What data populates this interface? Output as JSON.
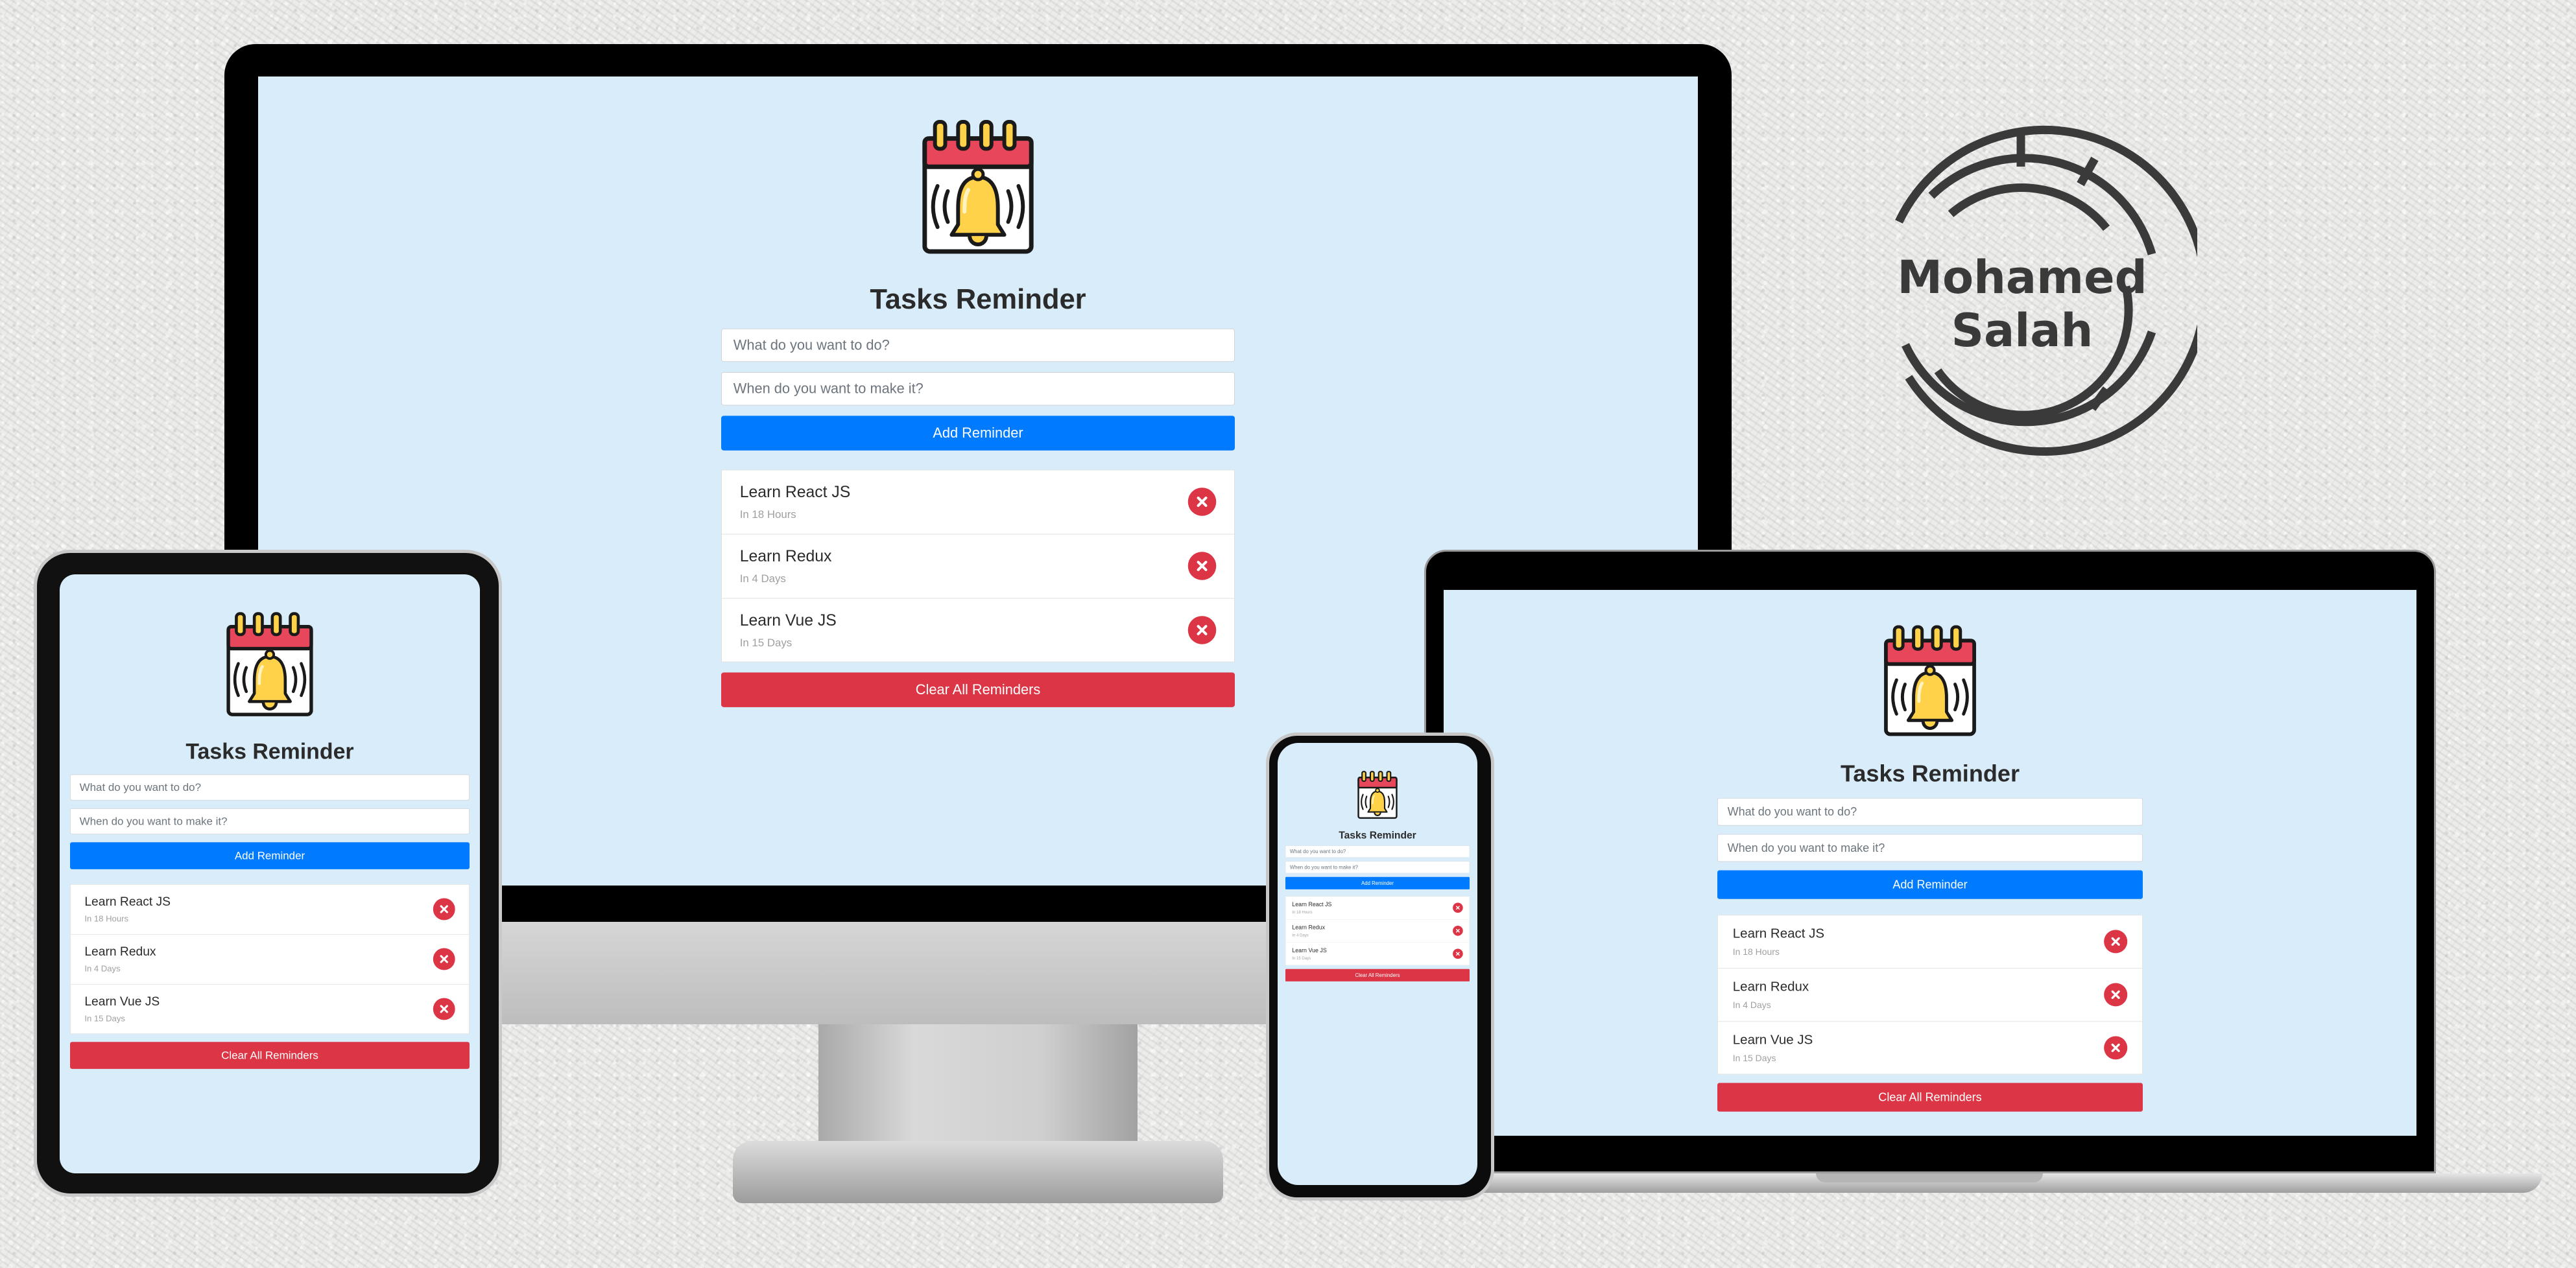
{
  "app": {
    "title": "Tasks Reminder",
    "task_placeholder": "What do you want to do?",
    "date_placeholder": "When do you want to make it?",
    "add_label": "Add Reminder",
    "clear_label": "Clear All Reminders",
    "items": [
      {
        "title": "Learn React JS",
        "time": "In 18 Hours"
      },
      {
        "title": "Learn Redux",
        "time": "In 4 Days"
      },
      {
        "title": "Learn Vue JS",
        "time": "In 15 Days"
      }
    ],
    "colors": {
      "background": "#d8ecfa",
      "primary": "#007bff",
      "danger": "#dc3545",
      "calendar_red": "#e8475b",
      "bell_yellow": "#ffd24a"
    },
    "icons": [
      "calendar-bell-icon",
      "delete-icon"
    ]
  },
  "seal": {
    "line1": "Mohamed",
    "line2": "Salah"
  },
  "devices": [
    "desktop-monitor",
    "laptop",
    "tablet",
    "phone"
  ]
}
